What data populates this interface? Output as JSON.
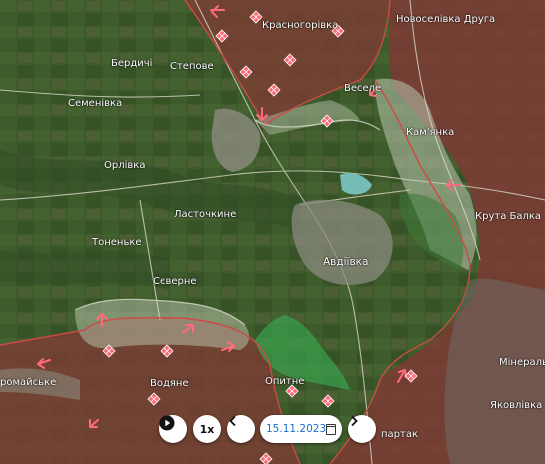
{
  "map": {
    "place_labels": [
      {
        "id": "novoselivka-druha",
        "text": "Новоселівка Друга"
      },
      {
        "id": "krasnohorivka",
        "text": "Красногорівка"
      },
      {
        "id": "berdychi",
        "text": "Бердичі"
      },
      {
        "id": "stepove",
        "text": "Степове"
      },
      {
        "id": "vesele",
        "text": "Веселе"
      },
      {
        "id": "semenivka",
        "text": "Семенівка"
      },
      {
        "id": "kamianka",
        "text": "Кам'янка"
      },
      {
        "id": "orlivka",
        "text": "Орлівка"
      },
      {
        "id": "lastochkyne",
        "text": "Ласточкине"
      },
      {
        "id": "kruta-balka",
        "text": "Крута Балка"
      },
      {
        "id": "tonenke",
        "text": "Тоненьке"
      },
      {
        "id": "avdiivka",
        "text": "Авдіївка"
      },
      {
        "id": "severne",
        "text": "Сєверне"
      },
      {
        "id": "minerali",
        "text": "Мінераль"
      },
      {
        "id": "vodiane",
        "text": "Водяне"
      },
      {
        "id": "opytne",
        "text": "Опитне"
      },
      {
        "id": "pervomaiske",
        "text": "ромайське"
      },
      {
        "id": "yakovlivka",
        "text": "Яковлівка"
      },
      {
        "id": "spartak",
        "text": "партак"
      }
    ],
    "colors": {
      "occupied_fill": "#8a3a36",
      "frontline_stroke": "#d14a44",
      "contested_fill": "#b8c9aa",
      "liberated_fill": "#3c9a4c",
      "attack_arrow": "#ff5a6e",
      "city": "#8a8a7d"
    },
    "icons": {
      "assault_marker": "red-diamond-grid-icon",
      "attack_direction": "red-arrow-icon"
    }
  },
  "controls": {
    "play_icon": "play-icon",
    "speed_label": "1x",
    "prev_icon": "chevron-left-icon",
    "date_value": "15.11.2023",
    "calendar_icon": "calendar-icon",
    "next_icon": "chevron-right-icon"
  }
}
